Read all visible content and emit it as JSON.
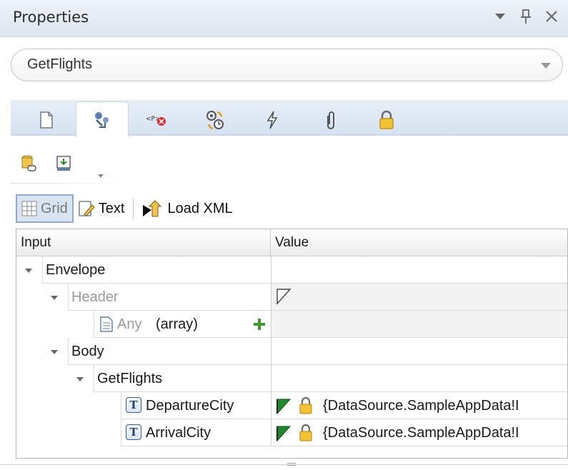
{
  "panel": {
    "title": "Properties",
    "controls": [
      "dropdown-icon",
      "pin-icon",
      "close-icon"
    ]
  },
  "operation": {
    "selected": "GetFlights"
  },
  "tabs": [
    {
      "icon": "page-icon",
      "active": false
    },
    {
      "icon": "input-mapping-icon",
      "active": true
    },
    {
      "icon": "checkpoint-icon",
      "active": false
    },
    {
      "icon": "timer-sync-icon",
      "active": false
    },
    {
      "icon": "event-icon",
      "active": false
    },
    {
      "icon": "attachment-icon",
      "active": false
    },
    {
      "icon": "security-lock-icon",
      "active": false
    }
  ],
  "small_toolbar": {
    "buttons": [
      "link-datasource-icon",
      "import-icon"
    ]
  },
  "view_toolbar": {
    "grid_label": "Grid",
    "text_label": "Text",
    "load_label": "Load XML"
  },
  "table": {
    "headers": {
      "input": "Input",
      "value": "Value"
    },
    "rows": [
      {
        "name": "Envelope",
        "value": ""
      },
      {
        "name": "Header",
        "value": ""
      },
      {
        "name": "Any",
        "extra": "(array)",
        "value": ""
      },
      {
        "name": "Body",
        "value": ""
      },
      {
        "name": "GetFlights",
        "value": ""
      },
      {
        "name": "DepartureCity",
        "value": "{DataSource.SampleAppData!I"
      },
      {
        "name": "ArrivalCity",
        "value": "{DataSource.SampleAppData!I"
      }
    ]
  },
  "colors": {
    "accent": "#d6e2f1",
    "flag_green": "#1f8a2b",
    "lock_gold": "#d9a017"
  }
}
